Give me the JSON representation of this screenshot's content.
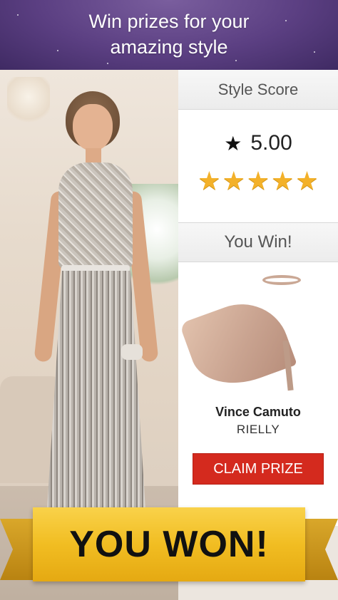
{
  "promo": {
    "title_line1": "Win prizes for your",
    "title_line2": "amazing style"
  },
  "score": {
    "header": "Style Score",
    "value": "5.00",
    "star_icon": "★",
    "rating_stars": 5
  },
  "prize": {
    "header": "You Win!",
    "brand": "Vince Camuto",
    "model": "RIELLY",
    "claim_label": "CLAIM PRIZE"
  },
  "banner": {
    "text": "YOU WON!"
  },
  "colors": {
    "header_purple": "#5b3f82",
    "star_gold": "#f3b12a",
    "claim_red": "#d42a1e",
    "banner_yellow": "#f1bd22"
  }
}
